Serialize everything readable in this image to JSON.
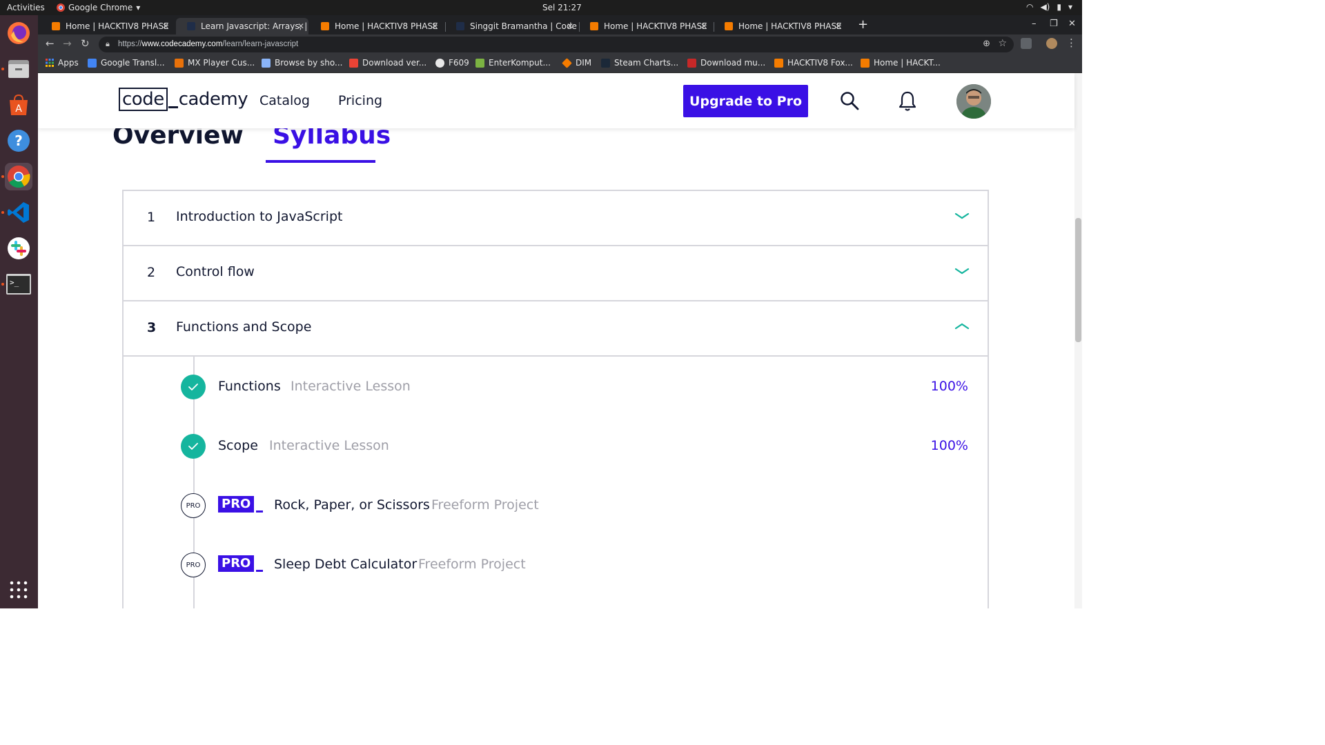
{
  "os": {
    "activities": "Activities",
    "app_name": "Google Chrome",
    "clock": "Sel 21:27"
  },
  "browser": {
    "tabs": [
      {
        "title": "Home | HACKTIV8 PHASE",
        "active": false
      },
      {
        "title": "Learn Javascript: Arrays, |",
        "active": true
      },
      {
        "title": "Home | HACKTIV8 PHASE",
        "active": false
      },
      {
        "title": "Singgit Bramantha | Code",
        "active": false
      },
      {
        "title": "Home | HACKTIV8 PHASE",
        "active": false
      },
      {
        "title": "Home | HACKTIV8 PHASE",
        "active": false
      }
    ],
    "url_prefix": "https://",
    "url_host": "www.codecademy.com",
    "url_path": "/learn/learn-javascript",
    "bookmarks": [
      {
        "label": "Apps",
        "color": "#4285f4"
      },
      {
        "label": "Google Transl...",
        "color": "#4285f4"
      },
      {
        "label": "MX Player Cus...",
        "color": "#e8710a"
      },
      {
        "label": "Browse by sho...",
        "color": "#8ab4f8"
      },
      {
        "label": "Download ver...",
        "color": "#ea4335"
      },
      {
        "label": "F609",
        "color": "#e8e8e8"
      },
      {
        "label": "EnterKomput...",
        "color": "#7cb342"
      },
      {
        "label": "DIM",
        "color": "#f57c00"
      },
      {
        "label": "Steam Charts...",
        "color": "#1b2838"
      },
      {
        "label": "Download mu...",
        "color": "#c62828"
      },
      {
        "label": "HACKTIV8 Fox...",
        "color": "#f57c00"
      },
      {
        "label": "Home | HACKT...",
        "color": "#f57c00"
      }
    ]
  },
  "header": {
    "logo_code": "code",
    "logo_cademy": "cademy",
    "nav": [
      "Catalog",
      "Pricing"
    ],
    "upgrade_label": "Upgrade to Pro"
  },
  "page_tabs": {
    "overview": "Overview",
    "syllabus": "Syllabus"
  },
  "modules": [
    {
      "num": "1",
      "title": "Introduction to JavaScript",
      "expanded": false
    },
    {
      "num": "2",
      "title": "Control flow",
      "expanded": false
    },
    {
      "num": "3",
      "title": "Functions and Scope",
      "expanded": true
    }
  ],
  "lessons": [
    {
      "name": "Functions",
      "type": "Interactive Lesson",
      "progress": "100%",
      "completed": true,
      "pro": false
    },
    {
      "name": "Scope",
      "type": "Interactive Lesson",
      "progress": "100%",
      "completed": true,
      "pro": false
    },
    {
      "name": "Rock, Paper, or Scissors",
      "type": "Freeform Project",
      "progress": "",
      "completed": false,
      "pro": true,
      "pro_badge": "PRO",
      "pro_tag": "PRO"
    },
    {
      "name": "Sleep Debt Calculator",
      "type": "Freeform Project",
      "progress": "",
      "completed": false,
      "pro": true,
      "pro_badge": "PRO",
      "pro_tag": "PRO"
    }
  ],
  "colors": {
    "brand_purple": "#3a10e5",
    "brand_navy": "#10162f",
    "success_teal": "#15b59e",
    "muted_text": "#9e9ea7"
  }
}
